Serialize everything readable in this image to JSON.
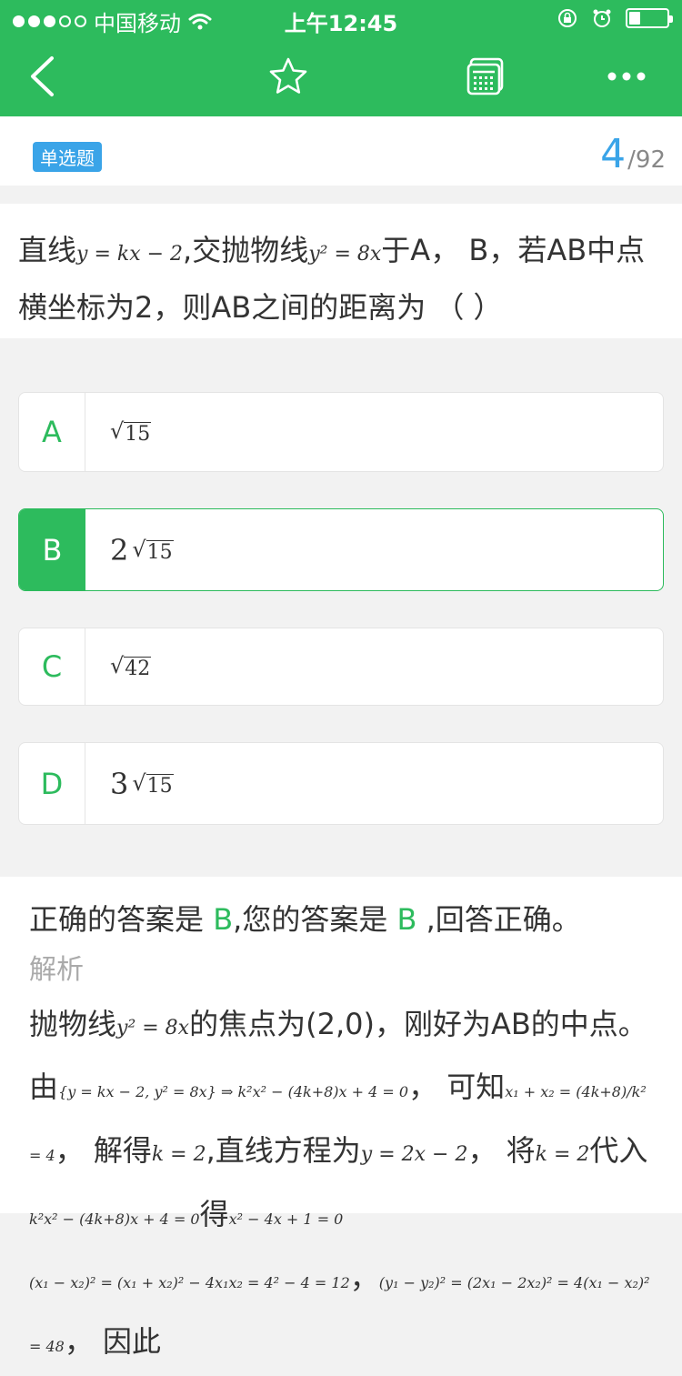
{
  "status": {
    "carrier": "中国移动",
    "time": "上午12:45",
    "battery_level": 0.3
  },
  "nav": {
    "back_icon": "back-chevron-icon",
    "favorite_icon": "star-icon",
    "answer_sheet_icon": "calculator-grid-icon",
    "more_icon": "more-dots-icon"
  },
  "header": {
    "question_type": "单选题",
    "current": "4",
    "total": "/92"
  },
  "question": {
    "text_1": "直线",
    "math_1": "y = kx − 2",
    "text_2": ",交抛物线",
    "math_2": "y² = 8x",
    "text_3": "于A， B，若AB中点横坐标为2，则AB之间的距离为 （ ）"
  },
  "options": [
    {
      "letter": "A",
      "coef": "",
      "radicand": "15"
    },
    {
      "letter": "B",
      "coef": "2",
      "radicand": "15"
    },
    {
      "letter": "C",
      "coef": "",
      "radicand": "42"
    },
    {
      "letter": "D",
      "coef": "3",
      "radicand": "15"
    }
  ],
  "answer": {
    "correct_prefix": "正确的答案是 ",
    "correct": "B",
    "yours_prefix": ",您的答案是 ",
    "yours": "B",
    "result": " ,回答正确。",
    "label": "解析",
    "p1_a": "抛物线",
    "p1_math": "y² = 8x",
    "p1_b": "的焦点为(2,0)，刚好为AB的中点。",
    "p2_a": "由",
    "p2_math1": "{y = kx − 2, y² = 8x} ⇒ k²x² − (4k+8)x + 4 = 0",
    "p2_b": "， 可知",
    "p2_math2": "x₁ + x₂ = (4k+8)/k² = 4",
    "p2_c": "， 解得",
    "p2_math3": "k = 2",
    "p2_d": ",直线方程为",
    "p2_math4": "y = 2x − 2",
    "p2_e": "， 将",
    "p2_math5": "k = 2",
    "p2_f": "代入",
    "p2_math6": "k²x² − (4k+8)x + 4 = 0",
    "p2_g": "得",
    "p2_math7": "x² − 4x + 1 = 0",
    "p3_math1": "(x₁ − x₂)² = (x₁ + x₂)² − 4x₁x₂ = 4² − 4 = 12",
    "p3_a": "，",
    "p3_math2": "(y₁ − y₂)² = (2x₁ − 2x₂)² = 4(x₁ − x₂)² = 48",
    "p3_b": "， 因此"
  }
}
